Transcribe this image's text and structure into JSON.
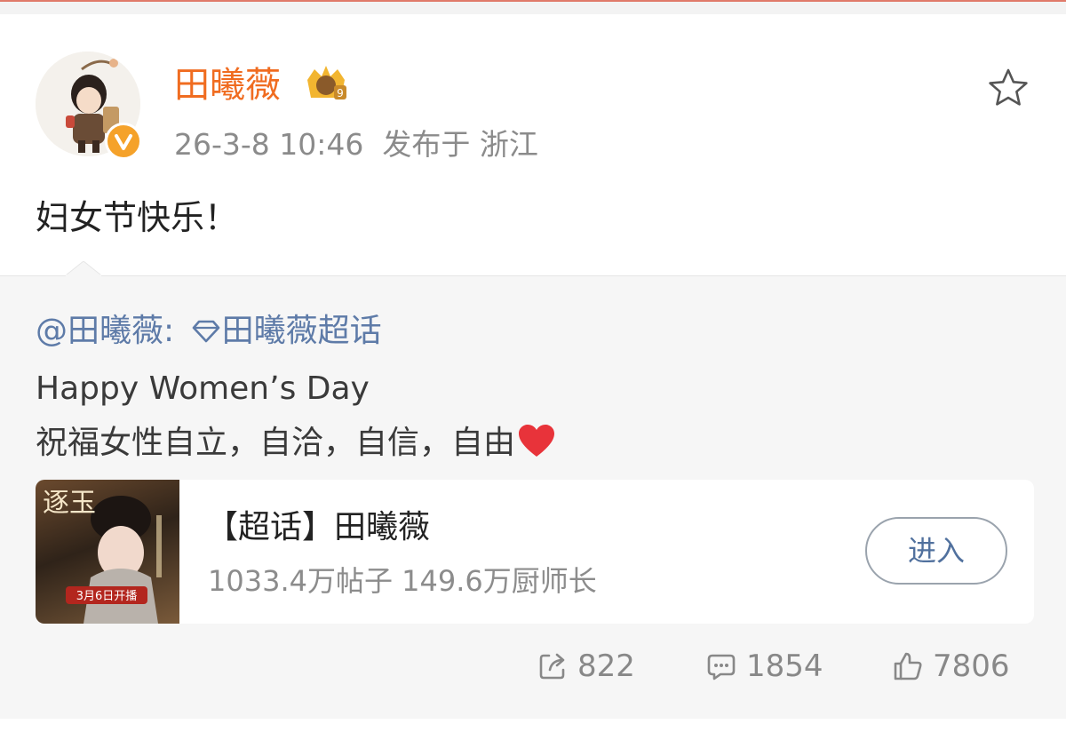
{
  "post": {
    "username": "田曦薇",
    "level_badge_icon": "crown-badge-icon",
    "level_number": "9",
    "timestamp": "26-3-8 10:46",
    "location": "发布于 浙江",
    "text": "妇女节快乐！"
  },
  "repost": {
    "author_mention": "@田曦薇:",
    "topic_link": "田曦薇超话",
    "line1": "Happy Women’s Day",
    "line2": "祝福女性自立，自洽，自信，自由"
  },
  "topic_card": {
    "title": "【超话】田曦薇",
    "stats": "1033.4万帖子 149.6万厨师长",
    "enter_label": "进入",
    "thumb_text_top": "逐玉",
    "thumb_text_date": "3月6日开播"
  },
  "actions": {
    "share_count": "822",
    "comment_count": "1854",
    "like_count": "7806"
  },
  "colors": {
    "username": "#f06c20",
    "link": "#5e7ba8",
    "verified_badge": "#f5a22a"
  }
}
